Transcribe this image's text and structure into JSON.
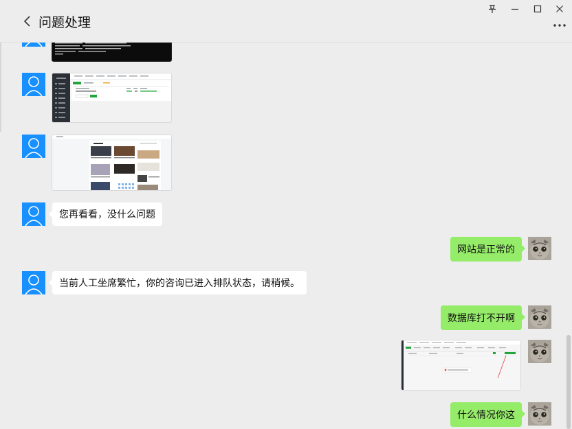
{
  "header": {
    "title": "问题处理",
    "back_icon": "chevron-left-icon",
    "pin_icon": "pin-icon",
    "minimize_icon": "minimize-icon",
    "maximize_icon": "maximize-icon",
    "close_icon": "close-icon",
    "more_icon": "more-dots-icon"
  },
  "colors": {
    "background": "#ededed",
    "bubble_self": "#95ec69",
    "bubble_other": "#ffffff",
    "avatar_blue": "#1890ff"
  },
  "messages": [
    {
      "side": "left",
      "type": "image",
      "content": "terminal-screenshot"
    },
    {
      "side": "left",
      "type": "image",
      "content": "admin-panel-screenshot"
    },
    {
      "side": "left",
      "type": "image",
      "content": "website-screenshot"
    },
    {
      "side": "left",
      "type": "text",
      "text": "您再看看，没什么问题"
    },
    {
      "side": "right",
      "type": "text",
      "text": "网站是正常的"
    },
    {
      "side": "left",
      "type": "text",
      "text": "当前人工坐席繁忙，你的咨询已进入排队状态，请稍候。"
    },
    {
      "side": "right",
      "type": "text",
      "text": "数据库打不开啊"
    },
    {
      "side": "right",
      "type": "image",
      "content": "database-error-screenshot"
    },
    {
      "side": "right",
      "type": "text",
      "text": "什么情况你这"
    }
  ]
}
